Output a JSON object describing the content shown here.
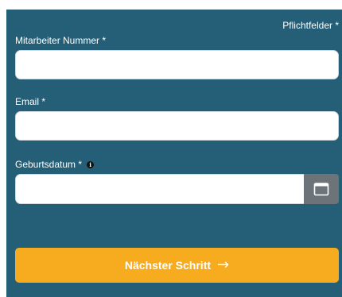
{
  "form": {
    "required_note": "Pflichtfelder *",
    "employee_number": {
      "label": "Mitarbeiter Nummer *",
      "value": "",
      "placeholder": ""
    },
    "email": {
      "label": "Email *",
      "value": "",
      "placeholder": ""
    },
    "birthdate": {
      "label": "Geburtsdatum *",
      "info_icon": "i",
      "value": "",
      "placeholder": "",
      "calendar_icon": "calendar-icon"
    },
    "next_button": {
      "label": "Nächster Schritt",
      "arrow": "→"
    }
  },
  "colors": {
    "panel": "#255f77",
    "button": "#f6ac1e",
    "calendar_button": "#6c7379"
  }
}
